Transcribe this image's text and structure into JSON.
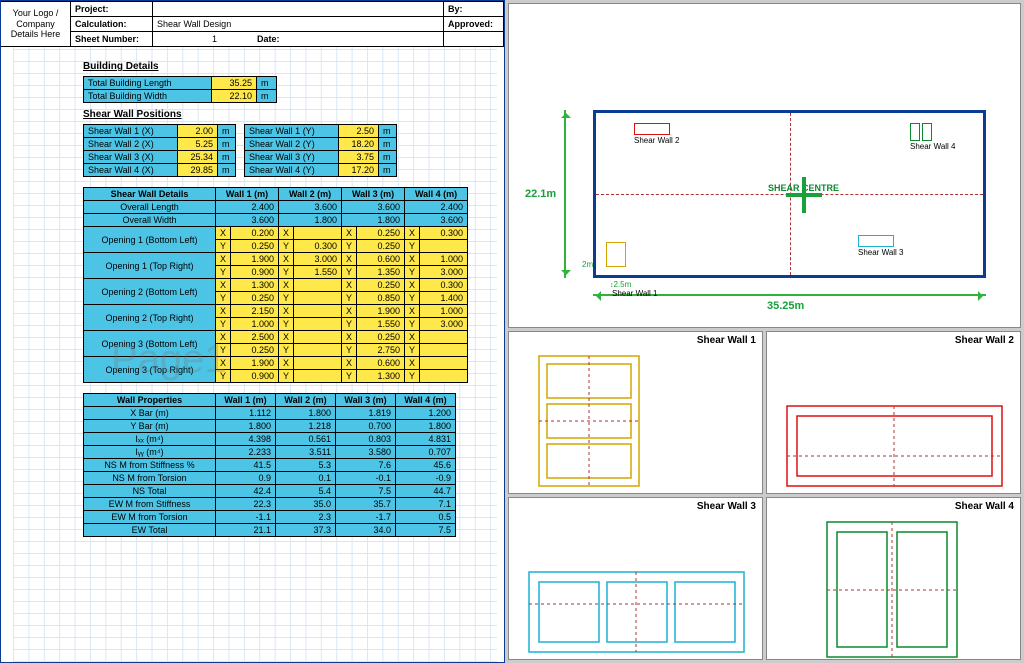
{
  "domain": "Document",
  "header": {
    "logo": "Your Logo / Company Details Here",
    "project_lbl": "Project:",
    "by_lbl": "By:",
    "calc_lbl": "Calculation:",
    "calc_val": "Shear Wall Design",
    "approved_lbl": "Approved:",
    "sheet_lbl": "Sheet Number:",
    "sheet_val": "1",
    "date_lbl": "Date:"
  },
  "watermark": "Page1",
  "building_details": {
    "title": "Building Details",
    "rows": [
      [
        "Total Building Length",
        "35.25",
        "m"
      ],
      [
        "Total Building Width",
        "22.10",
        "m"
      ]
    ]
  },
  "positions": {
    "title": "Shear Wall Positions",
    "rows": [
      [
        "Shear Wall 1 (X)",
        "2.00",
        "m",
        "Shear Wall 1 (Y)",
        "2.50",
        "m"
      ],
      [
        "Shear Wall 2 (X)",
        "5.25",
        "m",
        "Shear Wall 2 (Y)",
        "18.20",
        "m"
      ],
      [
        "Shear Wall 3 (X)",
        "25.34",
        "m",
        "Shear Wall 3 (Y)",
        "3.75",
        "m"
      ],
      [
        "Shear Wall 4 (X)",
        "29.85",
        "m",
        "Shear Wall 4 (Y)",
        "17.20",
        "m"
      ]
    ]
  },
  "details": {
    "title": "Shear Wall Details",
    "columns": [
      "Wall 1 (m)",
      "Wall 2 (m)",
      "Wall 3 (m)",
      "Wall 4 (m)"
    ],
    "overall_length": [
      "2.400",
      "3.600",
      "3.600",
      "2.400"
    ],
    "overall_width": [
      "3.600",
      "1.800",
      "1.800",
      "3.600"
    ],
    "labels": {
      "ol": "Overall Length",
      "ow": "Overall Width",
      "o1bl": "Opening 1 (Bottom Left)",
      "o1tr": "Opening 1 (Top Right)",
      "o2bl": "Opening 2 (Bottom Left)",
      "o2tr": "Opening 2 (Top Right)",
      "o3bl": "Opening 3 (Bottom Left)",
      "o3tr": "Opening 3 (Top Right)"
    },
    "openings": {
      "o1bl": {
        "x": [
          "0.200",
          "",
          "0.250",
          "0.300"
        ],
        "y": [
          "0.250",
          "0.300",
          "0.250",
          ""
        ]
      },
      "o1tr": {
        "x": [
          "1.900",
          "3.000",
          "0.600",
          "1.000"
        ],
        "y": [
          "0.900",
          "1.550",
          "1.350",
          "3.000"
        ]
      },
      "o2bl": {
        "x": [
          "1.300",
          "",
          "0.250",
          "0.300"
        ],
        "y": [
          "0.250",
          "",
          "0.850",
          "1.400"
        ]
      },
      "o2tr": {
        "x": [
          "2.150",
          "",
          "1.900",
          "1.000"
        ],
        "y": [
          "1.000",
          "",
          "1.550",
          "3.000"
        ]
      },
      "o3bl": {
        "x": [
          "2.500",
          "",
          "0.250",
          ""
        ],
        "y": [
          "0.250",
          "",
          "2.750",
          ""
        ]
      },
      "o3tr": {
        "x": [
          "1.900",
          "",
          "0.600",
          ""
        ],
        "y": [
          "0.900",
          "",
          "1.300",
          ""
        ]
      }
    }
  },
  "properties": {
    "title": "Wall Properties",
    "columns": [
      "Wall 1 (m)",
      "Wall 2 (m)",
      "Wall 3 (m)",
      "Wall 4 (m)"
    ],
    "rows": [
      [
        "X Bar (m)",
        "1.112",
        "1.800",
        "1.819",
        "1.200"
      ],
      [
        "Y Bar (m)",
        "1.800",
        "1.218",
        "0.700",
        "1.800"
      ],
      [
        "Iₓₓ (m⁴)",
        "4.398",
        "0.561",
        "0.803",
        "4.831"
      ],
      [
        "Iᵧᵧ (m⁴)",
        "2.233",
        "3.511",
        "3.580",
        "0.707"
      ],
      [
        "NS M from Stiffness %",
        "41.5",
        "5.3",
        "7.6",
        "45.6"
      ],
      [
        "NS M from Torsion",
        "0.9",
        "0.1",
        "-0.1",
        "-0.9"
      ],
      [
        "NS Total",
        "42.4",
        "5.4",
        "7.5",
        "44.7"
      ],
      [
        "EW M from Stiffness",
        "22.3",
        "35.0",
        "35.7",
        "7.1"
      ],
      [
        "EW M from Torsion",
        "-1.1",
        "2.3",
        "-1.7",
        "0.5"
      ],
      [
        "EW Total",
        "21.1",
        "37.3",
        "34.0",
        "7.5"
      ]
    ]
  },
  "plan": {
    "shear_centre": "SHEAR CENTRE",
    "dim_x": "35.25m",
    "dim_y": "22.1m",
    "dim_sw1x": "2m",
    "dim_sw1y": "2.5m",
    "walls": [
      "Shear Wall 1",
      "Shear Wall 2",
      "Shear Wall 3",
      "Shear Wall 4"
    ]
  },
  "minis": [
    "Shear Wall 1",
    "Shear Wall 2",
    "Shear Wall 3",
    "Shear Wall 4"
  ],
  "chart_data": {
    "type": "table",
    "plan_dimensions_m": {
      "length": 35.25,
      "width": 22.1
    },
    "wall_positions_m": [
      {
        "name": "Shear Wall 1",
        "x": 2.0,
        "y": 2.5
      },
      {
        "name": "Shear Wall 2",
        "x": 5.25,
        "y": 18.2
      },
      {
        "name": "Shear Wall 3",
        "x": 25.34,
        "y": 3.75
      },
      {
        "name": "Shear Wall 4",
        "x": 29.85,
        "y": 17.2
      }
    ],
    "wall_overall_m": [
      {
        "name": "Shear Wall 1",
        "length": 2.4,
        "width": 3.6
      },
      {
        "name": "Shear Wall 2",
        "length": 3.6,
        "width": 1.8
      },
      {
        "name": "Shear Wall 3",
        "length": 3.6,
        "width": 1.8
      },
      {
        "name": "Shear Wall 4",
        "length": 2.4,
        "width": 3.6
      }
    ],
    "wall_properties": {
      "X_Bar_m": [
        1.112,
        1.8,
        1.819,
        1.2
      ],
      "Y_Bar_m": [
        1.8,
        1.218,
        0.7,
        1.8
      ],
      "Ixx_m4": [
        4.398,
        0.561,
        0.803,
        4.831
      ],
      "Iyy_m4": [
        2.233,
        3.511,
        3.58,
        0.707
      ],
      "NS_M_from_Stiffness_pct": [
        41.5,
        5.3,
        7.6,
        45.6
      ],
      "NS_M_from_Torsion": [
        0.9,
        0.1,
        -0.1,
        -0.9
      ],
      "NS_Total": [
        42.4,
        5.4,
        7.5,
        44.7
      ],
      "EW_M_from_Stiffness": [
        22.3,
        35.0,
        35.7,
        7.1
      ],
      "EW_M_from_Torsion": [
        -1.1,
        2.3,
        -1.7,
        0.5
      ],
      "EW_Total": [
        21.1,
        37.3,
        34.0,
        7.5
      ]
    }
  }
}
